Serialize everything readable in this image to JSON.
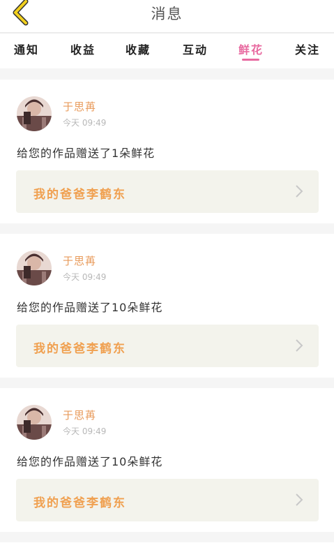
{
  "header": {
    "title": "消息"
  },
  "tabs": [
    {
      "label": "通知"
    },
    {
      "label": "收益"
    },
    {
      "label": "收藏"
    },
    {
      "label": "互动"
    },
    {
      "label": "鲜花",
      "active": true
    },
    {
      "label": "关注"
    }
  ],
  "colors": {
    "accent": "#e86aa0",
    "name": "#e89a5a",
    "work": "#f0a050",
    "back_icon": "#f2d01e"
  },
  "messages": [
    {
      "user": "于思苒",
      "time": "今天 09:49",
      "text": "给您的作品赠送了1朵鲜花",
      "work_title": "我的爸爸李鹤东"
    },
    {
      "user": "于思苒",
      "time": "今天 09:49",
      "text": "给您的作品赠送了10朵鲜花",
      "work_title": "我的爸爸李鹤东"
    },
    {
      "user": "于思苒",
      "time": "今天 09:49",
      "text": "给您的作品赠送了10朵鲜花",
      "work_title": "我的爸爸李鹤东"
    }
  ]
}
